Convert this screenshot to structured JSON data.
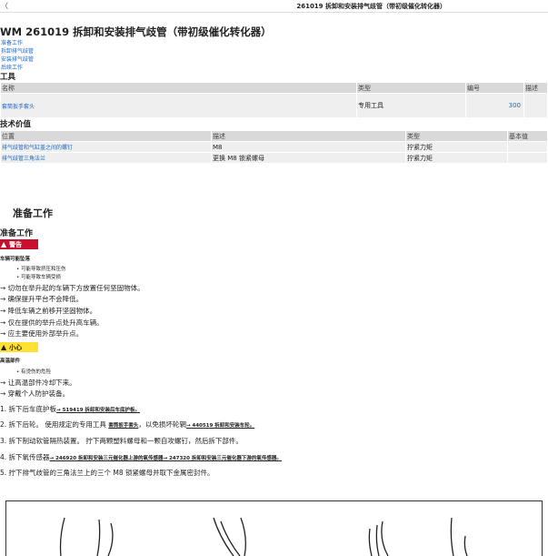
{
  "header": {
    "back_glyph": "〈",
    "title": "261019 拆卸和安装排气歧管（带初级催化转化器）"
  },
  "doc_title": "WM 261019 拆卸和安装排气歧管（带初级催化转化器）",
  "toc": [
    "准备工作",
    "拆卸排气歧管",
    "安装排气歧管",
    "后续工作"
  ],
  "tools": {
    "heading": "工具",
    "columns": [
      "名称",
      "类型",
      "编号",
      "描述"
    ],
    "rows": [
      {
        "name": "套筒扳手套头",
        "type": "专用工具",
        "number": "300",
        "desc": ""
      }
    ]
  },
  "tech": {
    "heading": "技术价值",
    "columns": [
      "位置",
      "描述",
      "类型",
      "基本值"
    ],
    "rows": [
      {
        "position": "排气歧管和气缸盖之间的螺钉",
        "desc": "M8",
        "type": "拧紧力矩",
        "value": ""
      },
      {
        "position": "排气歧管三角法兰",
        "desc": "更换 M8 锁紧螺母",
        "type": "拧紧力矩",
        "value": ""
      }
    ]
  },
  "prep": {
    "title": "准备工作",
    "subtitle": "准备工作",
    "warning_label": "警告",
    "warning_head": "车辆可能坠落",
    "warning_bullets": [
      "可能导致挤压和压伤",
      "可能导致车辆受损"
    ],
    "warning_actions": [
      "→ 切勿在举升起的车辆下方放置任何坚固物体。",
      "→ 确保提升平台不会降低。",
      "→ 降低车辆之前移开坚固物体。",
      "→ 仅在提供的举升点处升高车辆。",
      "→ 应主要使用外部举升点。"
    ],
    "caution_label": "小心",
    "caution_head": "高温部件",
    "caution_bullets": [
      "有烫伤的危险"
    ],
    "caution_actions": [
      "→ 让高温部件冷却下来。",
      "→ 穿戴个人防护装备。"
    ],
    "steps": [
      {
        "text": "1. 拆下后车底护板",
        "link": "→ 519419 拆卸和安装后车底护板。"
      },
      {
        "text": "2. 拆下后轮。 使用规定的专用工具",
        "link": "套筒扳手套头",
        "text2": "，以免损坏轮辋",
        "link2": "→ 440519 拆卸和安装车轮。"
      },
      {
        "text": "3. 拆下制动软管隔热装置。 拧下两颗塑料螺母和一颗自攻螺钉，然后拆下部件。"
      },
      {
        "text": "4. 拆下氧传感器",
        "link": "→ 246920 拆卸和安装三元催化器上游的氧传感器→ 247320 拆卸和安装三元催化器下游的氧传感器。"
      },
      {
        "text": "5. 拧下排气歧管的三角法兰上的三个 M8 锁紧螺母并取下金属密封件。"
      }
    ]
  }
}
